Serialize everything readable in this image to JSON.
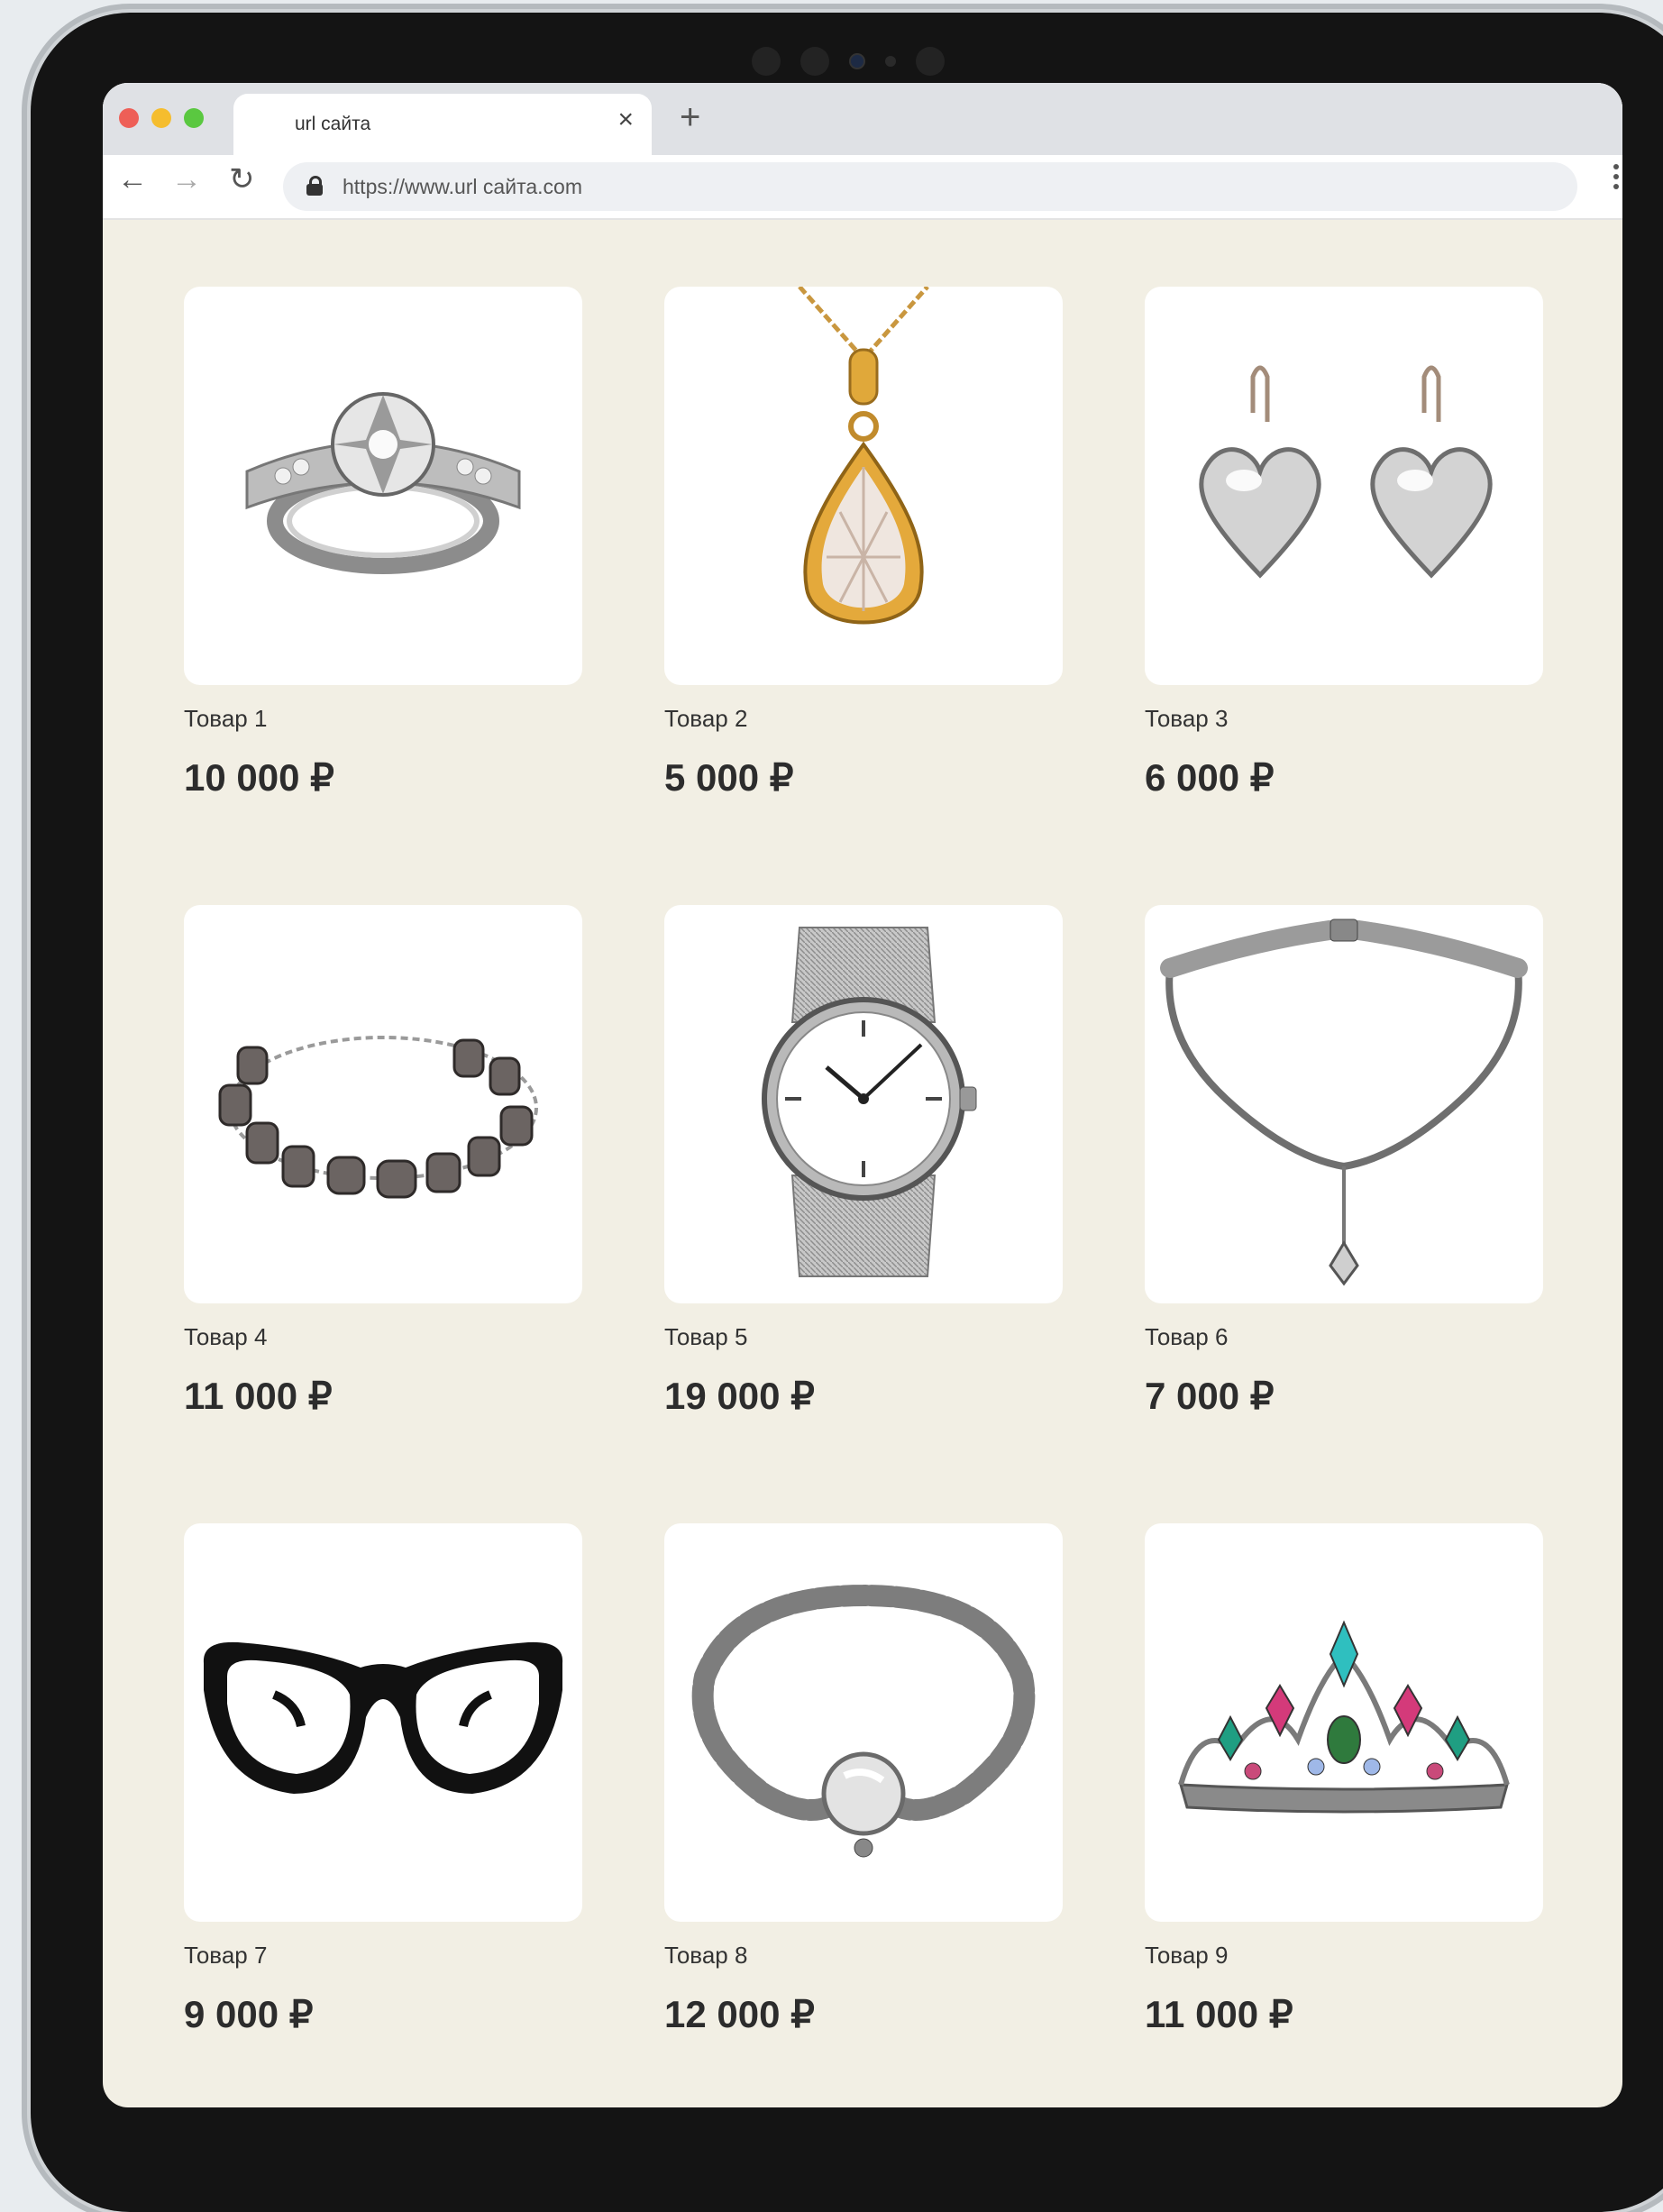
{
  "browser": {
    "tab_title": "url сайта",
    "tab_close": "×",
    "new_tab": "+",
    "url": "https://www.url сайта.com",
    "back": "←",
    "forward": "→",
    "reload": "↻",
    "dots": [
      "#ee5f57",
      "#f5bd2e",
      "#5ac840"
    ]
  },
  "colors": {
    "page_bg": "#f2efe4",
    "card_bg": "#ffffff"
  },
  "products": [
    {
      "name": "Товар 1",
      "price": "10 000 ₽",
      "icon": "ring-icon"
    },
    {
      "name": "Товар 2",
      "price": "5 000 ₽",
      "icon": "pendant-icon"
    },
    {
      "name": "Товар 3",
      "price": "6 000 ₽",
      "icon": "earrings-icon"
    },
    {
      "name": "Товар 4",
      "price": "11 000 ₽",
      "icon": "bead-bracelet-icon"
    },
    {
      "name": "Товар 5",
      "price": "19 000 ₽",
      "icon": "watch-icon"
    },
    {
      "name": "Товар 6",
      "price": "7 000 ₽",
      "icon": "choker-icon"
    },
    {
      "name": "Товар 7",
      "price": "9 000 ₽",
      "icon": "glasses-icon"
    },
    {
      "name": "Товар 8",
      "price": "12 000 ₽",
      "icon": "chain-bracelet-icon"
    },
    {
      "name": "Товар 9",
      "price": "11 000 ₽",
      "icon": "tiara-icon"
    }
  ]
}
